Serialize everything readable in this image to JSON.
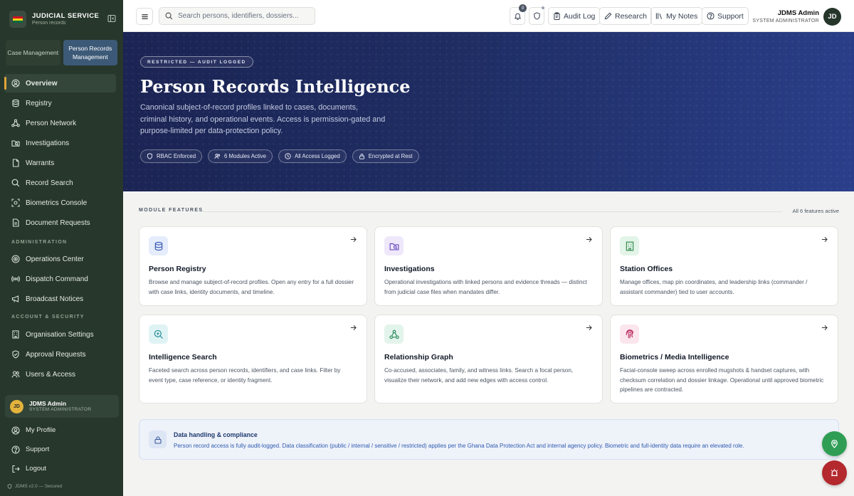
{
  "brand": {
    "title": "JUDICIAL SERVICE",
    "subtitle": "Person records"
  },
  "sidebar": {
    "tabs": [
      {
        "label": "Case Management",
        "active": false
      },
      {
        "label": "Person Records Management",
        "active": true
      }
    ],
    "nav": [
      {
        "label": "Overview",
        "icon": "user-circle-icon",
        "active": true
      },
      {
        "label": "Registry",
        "icon": "database-icon"
      },
      {
        "label": "Person Network",
        "icon": "network-icon"
      },
      {
        "label": "Investigations",
        "icon": "folder-search-icon"
      },
      {
        "label": "Warrants",
        "icon": "file-icon"
      },
      {
        "label": "Record Search",
        "icon": "search-icon"
      },
      {
        "label": "Biometrics Console",
        "icon": "scan-icon"
      },
      {
        "label": "Document Requests",
        "icon": "document-icon"
      }
    ],
    "admin_label": "ADMINISTRATION",
    "admin": [
      {
        "label": "Operations Center",
        "icon": "target-icon"
      },
      {
        "label": "Dispatch Command",
        "icon": "radio-icon"
      },
      {
        "label": "Broadcast Notices",
        "icon": "megaphone-icon"
      }
    ],
    "account_label": "ACCOUNT & SECURITY",
    "account": [
      {
        "label": "Organisation Settings",
        "icon": "building-icon"
      },
      {
        "label": "Approval Requests",
        "icon": "shield-check-icon"
      },
      {
        "label": "Users & Access",
        "icon": "users-icon"
      }
    ],
    "user": {
      "initials": "JD",
      "name": "JDMS Admin",
      "role": "SYSTEM ADMINISTRATOR"
    },
    "footer_nav": [
      {
        "label": "My Profile",
        "icon": "user-circle-icon"
      },
      {
        "label": "Support",
        "icon": "help-icon"
      },
      {
        "label": "Logout",
        "icon": "logout-icon"
      }
    ],
    "version": "JDMS v2.0 — Secured"
  },
  "topbar": {
    "search_placeholder": "Search persons, identifiers, dossiers...",
    "notification_count": "0",
    "audit_log": "Audit Log",
    "research": "Research",
    "my_notes": "My Notes",
    "support": "Support",
    "user": {
      "name": "JDMS Admin",
      "role": "SYSTEM ADMINISTRATOR",
      "initials": "JD"
    }
  },
  "hero": {
    "pill": "RESTRICTED — AUDIT LOGGED",
    "title": "Person Records Intelligence",
    "description": "Canonical subject-of-record profiles linked to cases, documents, criminal history, and operational events. Access is permission-gated and purpose-limited per data-protection policy.",
    "chips": [
      {
        "label": "RBAC Enforced",
        "icon": "shield-icon"
      },
      {
        "label": "6 Modules Active",
        "icon": "users-icon"
      },
      {
        "label": "All Access Logged",
        "icon": "clock-icon"
      },
      {
        "label": "Encrypted at Rest",
        "icon": "lock-icon"
      }
    ]
  },
  "features": {
    "label": "MODULE FEATURES",
    "status": "All 6 features active",
    "cards": [
      {
        "title": "Person Registry",
        "desc": "Browse and manage subject-of-record profiles. Open any entry for a full dossier with case links, identity documents, and timeline.",
        "icon": "database-icon",
        "bg": "#e5ecfb",
        "fg": "#3b5bb5"
      },
      {
        "title": "Investigations",
        "desc": "Operational investigations with linked persons and evidence threads — distinct from judicial case files when mandates differ.",
        "icon": "folder-search-icon",
        "bg": "#efe8fb",
        "fg": "#6d4bc0"
      },
      {
        "title": "Station Offices",
        "desc": "Manage offices, map pin coordinates, and leadership links (commander / assistant commander) tied to user accounts.",
        "icon": "building-icon",
        "bg": "#e3f4e8",
        "fg": "#2f8a4b"
      },
      {
        "title": "Intelligence Search",
        "desc": "Faceted search across person records, identifiers, and case links. Filter by event type, case reference, or identity fragment.",
        "icon": "search-zoom-icon",
        "bg": "#e0f3f4",
        "fg": "#238a93"
      },
      {
        "title": "Relationship Graph",
        "desc": "Co-accused, associates, family, and witness links. Search a focal person, visualize their network, and add new edges with access control.",
        "icon": "network-icon",
        "bg": "#e3f4ec",
        "fg": "#2b8b5d"
      },
      {
        "title": "Biometrics / Media Intelligence",
        "desc": "Facial-console sweep across enrolled mugshots & handset captures, with checksum correlation and dossier linkage. Operational until approved biometric pipelines are contracted.",
        "icon": "fingerprint-icon",
        "bg": "#fbe6ee",
        "fg": "#c03c6c"
      }
    ]
  },
  "compliance": {
    "title": "Data handling & compliance",
    "text": "Person record access is fully audit-logged. Data classification (public / internal / sensitive / restricted) applies per the Ghana Data Protection Act and internal agency policy. Biometric and full-identity data require an elevated role.",
    "icon": "lock-icon"
  },
  "fabs": [
    {
      "name": "location-fab",
      "icon": "map-pin-icon",
      "color": "#2f9e54"
    },
    {
      "name": "alert-fab",
      "icon": "alarm-icon",
      "color": "#b3292e"
    }
  ],
  "colors": {
    "sidebar": "#27372b",
    "accent": "#e0a53a",
    "hero": "#1f2d63"
  }
}
